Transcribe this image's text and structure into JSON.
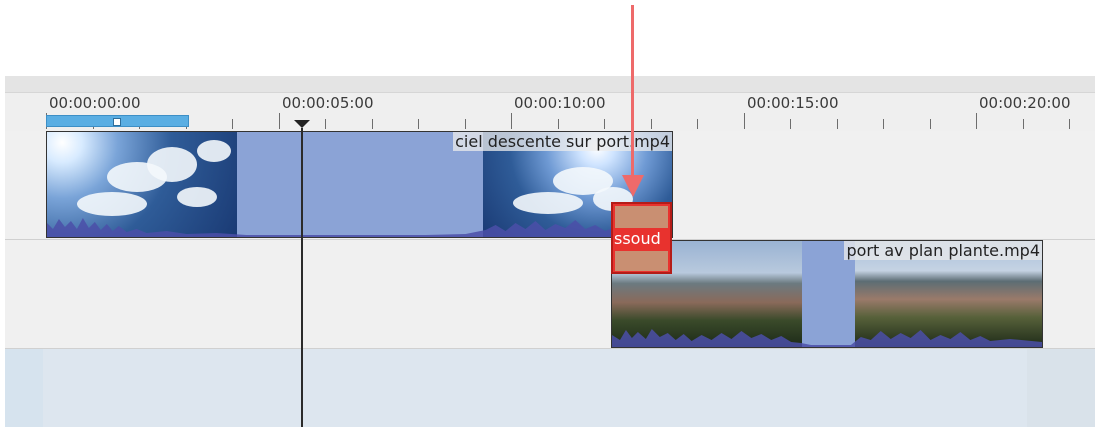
{
  "ruler": {
    "labels": [
      "00:00:00:00",
      "00:00:05:00",
      "00:00:10:00",
      "00:00:15:00",
      "00:00:20:00"
    ]
  },
  "tracks": {
    "v1": {
      "clip": {
        "name": "ciel descente sur port.mp4"
      }
    },
    "v2": {
      "clip": {
        "name": "port av plan plante.mp4"
      }
    }
  },
  "transition": {
    "label": "ssoud"
  },
  "colors": {
    "annotation_arrow": "#ee6a6a",
    "transition": "#e8322e",
    "zone": "#5aaee3",
    "clip": "#8ba3d6"
  }
}
